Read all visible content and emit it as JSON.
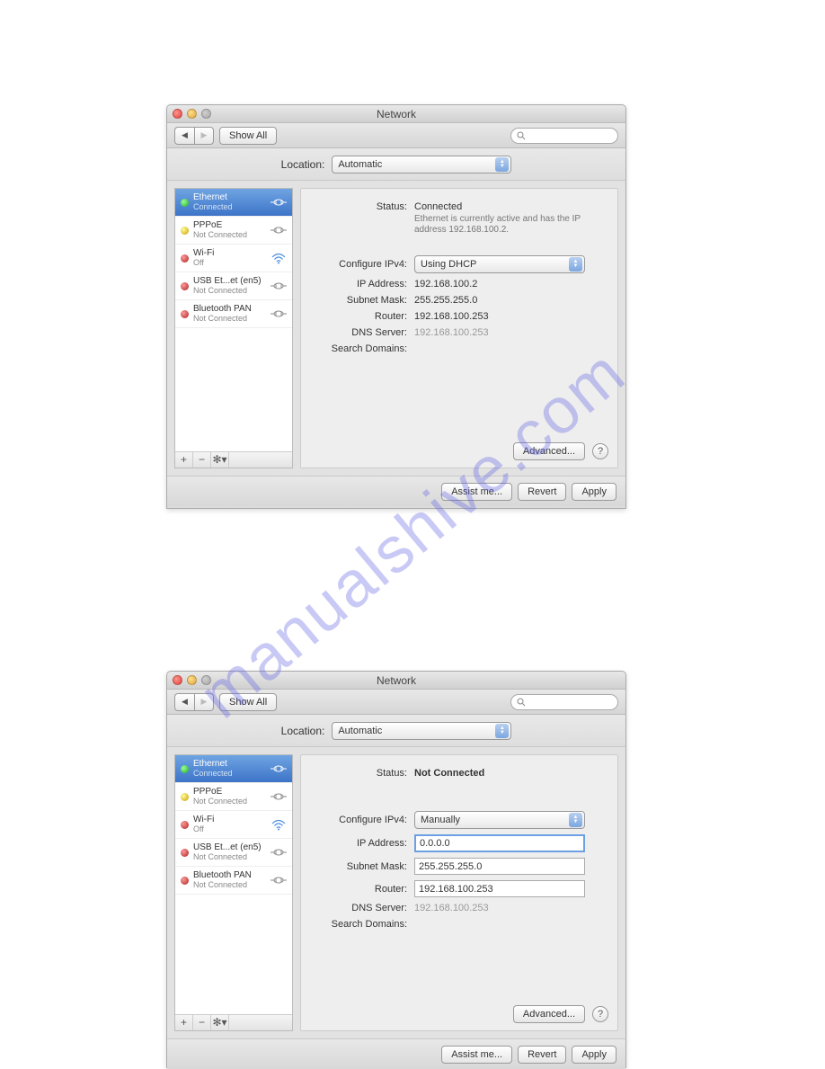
{
  "watermark": "manualshive.com",
  "win1": {
    "title": "Network",
    "toolbar": {
      "showall": "Show All"
    },
    "location_label": "Location:",
    "location_value": "Automatic",
    "sidebar": [
      {
        "name": "Ethernet",
        "sub": "Connected",
        "dot": "green",
        "icon": "eth",
        "sel": true
      },
      {
        "name": "PPPoE",
        "sub": "Not Connected",
        "dot": "yellow",
        "icon": "eth",
        "sel": false
      },
      {
        "name": "Wi-Fi",
        "sub": "Off",
        "dot": "red",
        "icon": "wifi",
        "sel": false
      },
      {
        "name": "USB Et...et (en5)",
        "sub": "Not Connected",
        "dot": "red",
        "icon": "eth",
        "sel": false
      },
      {
        "name": "Bluetooth PAN",
        "sub": "Not Connected",
        "dot": "red",
        "icon": "eth",
        "sel": false
      }
    ],
    "main": {
      "status_label": "Status:",
      "status_value": "Connected",
      "status_desc": "Ethernet is currently active and has the IP address 192.168.100.2.",
      "config_label": "Configure IPv4:",
      "config_value": "Using DHCP",
      "ip_label": "IP Address:",
      "ip_value": "192.168.100.2",
      "subnet_label": "Subnet Mask:",
      "subnet_value": "255.255.255.0",
      "router_label": "Router:",
      "router_value": "192.168.100.253",
      "dns_label": "DNS Server:",
      "dns_value": "192.168.100.253",
      "search_label": "Search Domains:",
      "advanced": "Advanced..."
    },
    "bottom": {
      "assist": "Assist me...",
      "revert": "Revert",
      "apply": "Apply"
    }
  },
  "win2": {
    "title": "Network",
    "toolbar": {
      "showall": "Show All"
    },
    "location_label": "Location:",
    "location_value": "Automatic",
    "sidebar": [
      {
        "name": "Ethernet",
        "sub": "Connected",
        "dot": "green",
        "icon": "eth",
        "sel": true
      },
      {
        "name": "PPPoE",
        "sub": "Not Connected",
        "dot": "yellow",
        "icon": "eth",
        "sel": false
      },
      {
        "name": "Wi-Fi",
        "sub": "Off",
        "dot": "red",
        "icon": "wifi",
        "sel": false
      },
      {
        "name": "USB Et...et (en5)",
        "sub": "Not Connected",
        "dot": "red",
        "icon": "eth",
        "sel": false
      },
      {
        "name": "Bluetooth PAN",
        "sub": "Not Connected",
        "dot": "red",
        "icon": "eth",
        "sel": false
      }
    ],
    "main": {
      "status_label": "Status:",
      "status_value": "Not Connected",
      "config_label": "Configure IPv4:",
      "config_value": "Manually",
      "ip_label": "IP Address:",
      "ip_value": "0.0.0.0",
      "subnet_label": "Subnet Mask:",
      "subnet_value": "255.255.255.0",
      "router_label": "Router:",
      "router_value": "192.168.100.253",
      "dns_label": "DNS Server:",
      "dns_value": "192.168.100.253",
      "search_label": "Search Domains:",
      "advanced": "Advanced..."
    },
    "bottom": {
      "assist": "Assist me...",
      "revert": "Revert",
      "apply": "Apply"
    }
  }
}
